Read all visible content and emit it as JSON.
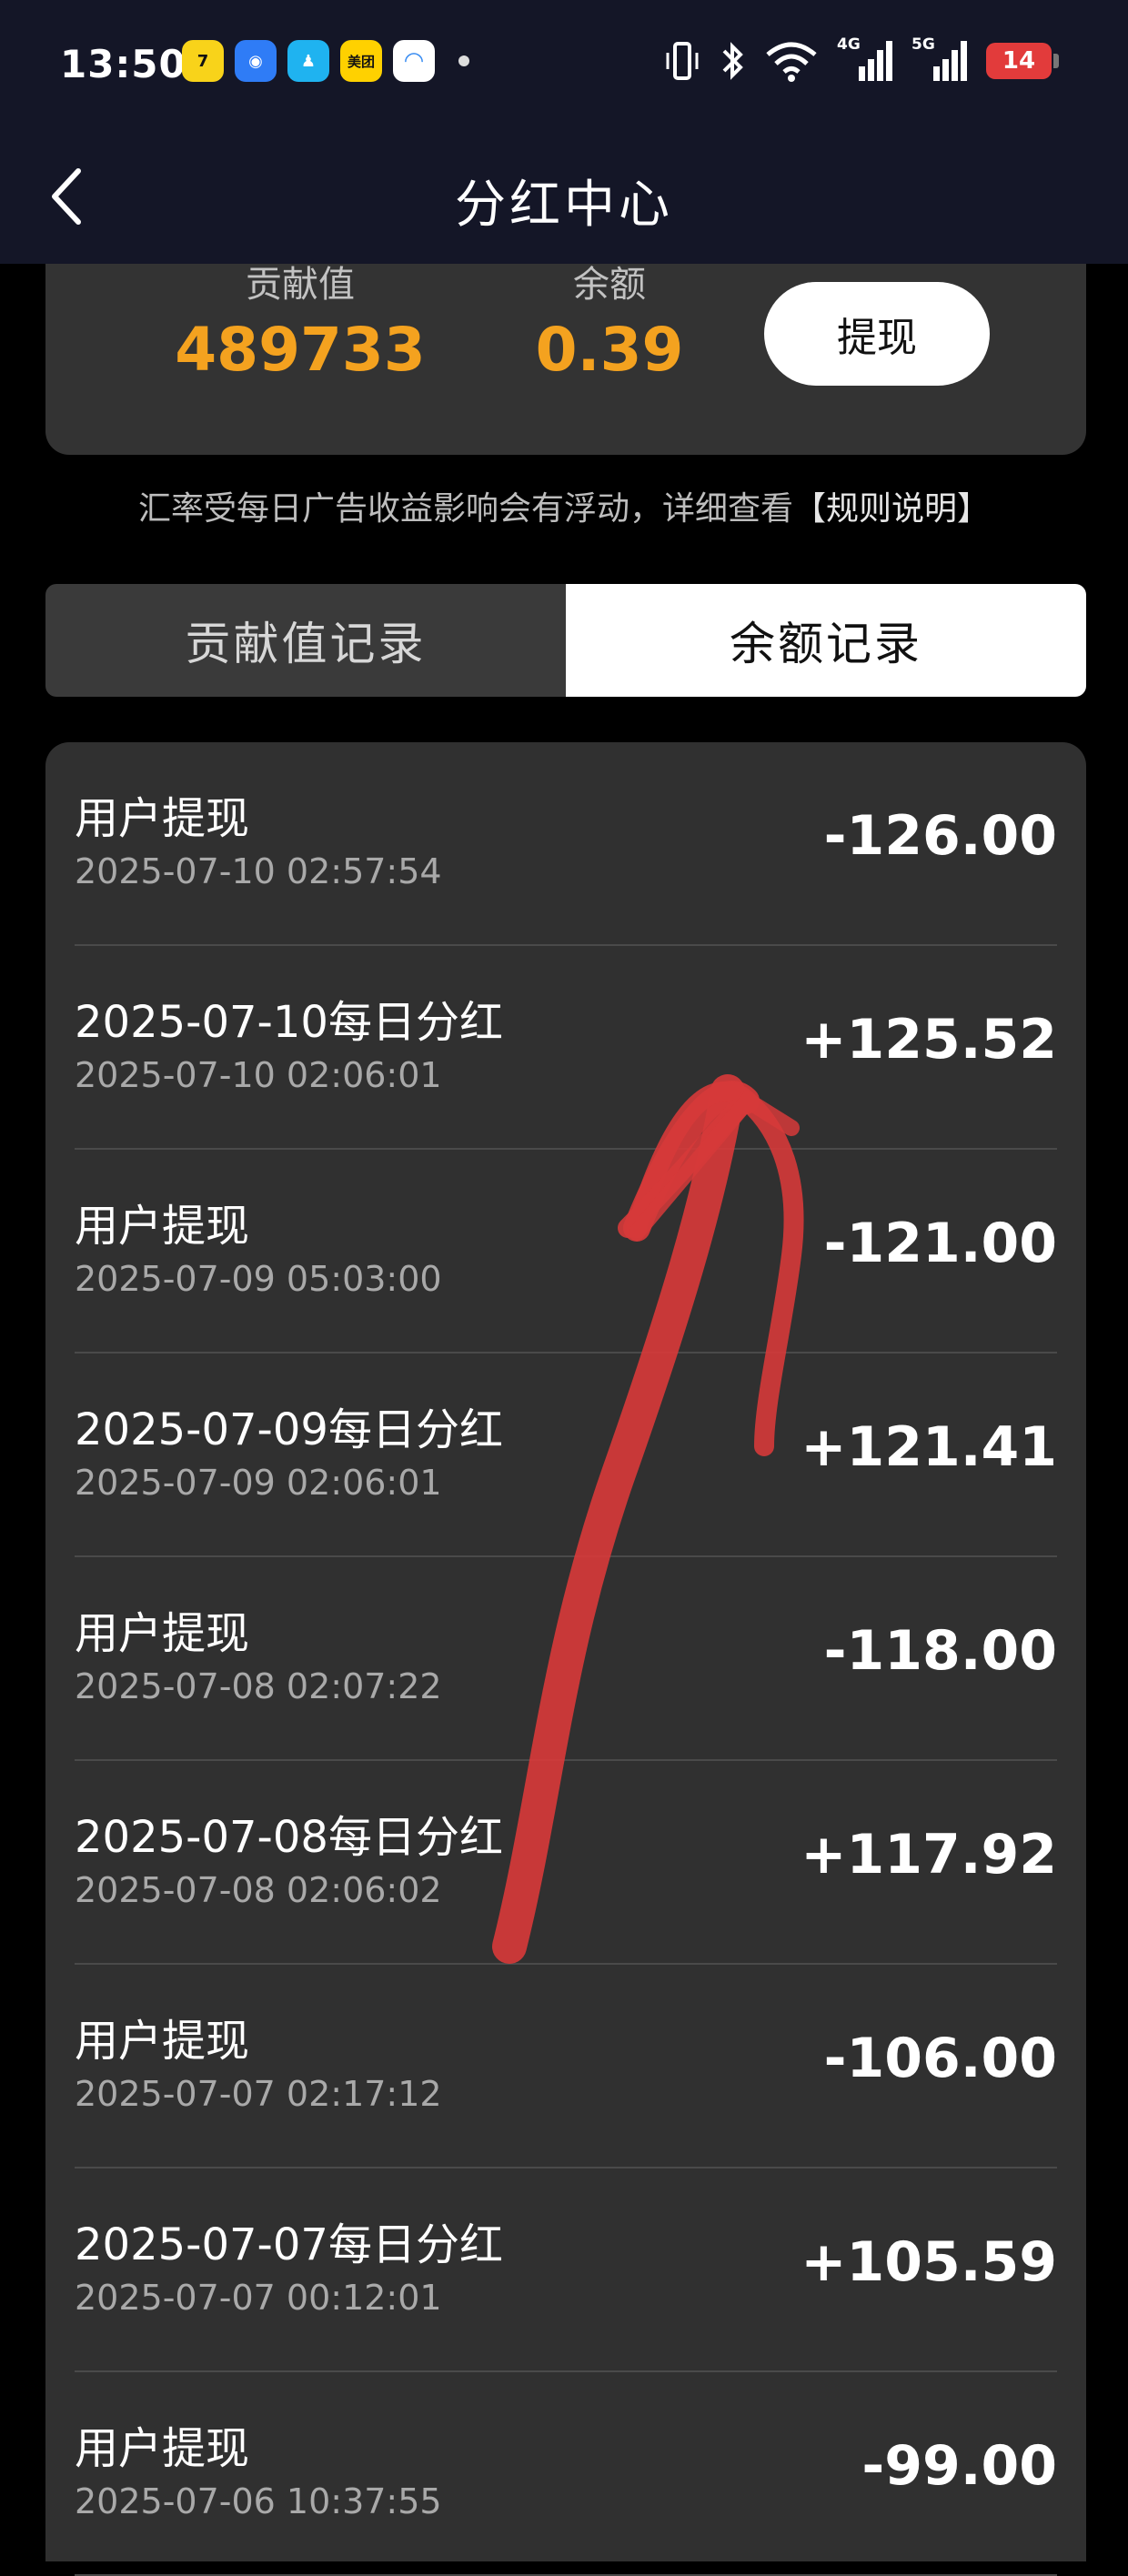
{
  "status_bar": {
    "time": "13:50",
    "apps": [
      {
        "icon": "tiger-app-icon",
        "glyph": "7",
        "color": "#f8d31a"
      },
      {
        "icon": "blue-app-icon",
        "glyph": "◉",
        "color": "#2f7cf6"
      },
      {
        "icon": "qq-penguin-icon",
        "glyph": "♟",
        "color": "#1fb3f0"
      },
      {
        "icon": "meituan-icon",
        "glyph": "美团",
        "color": "#ffd100"
      },
      {
        "icon": "blue-c-app-icon",
        "glyph": "◠",
        "color": "#3a8df2"
      }
    ],
    "net_4g": "4G",
    "net_5g": "5G",
    "battery": "14"
  },
  "header": {
    "title": "分红中心"
  },
  "summary": {
    "contribution_label": "贡献值",
    "contribution_value": "489733",
    "balance_label": "余额",
    "balance_value": "0.39",
    "withdraw_label": "提现"
  },
  "notice": {
    "text": "汇率受每日广告收益影响会有浮动，详细查看",
    "link": "【规则说明】"
  },
  "tabs": [
    {
      "label": "贡献值记录",
      "active": false
    },
    {
      "label": "余额记录",
      "active": true
    }
  ],
  "records": [
    {
      "title": "用户提现",
      "time": "2025-07-10 02:57:54",
      "amount": "-126.00"
    },
    {
      "title": "2025-07-10每日分红",
      "time": "2025-07-10 02:06:01",
      "amount": "+125.52"
    },
    {
      "title": "用户提现",
      "time": "2025-07-09 05:03:00",
      "amount": "-121.00"
    },
    {
      "title": "2025-07-09每日分红",
      "time": "2025-07-09 02:06:01",
      "amount": "+121.41"
    },
    {
      "title": "用户提现",
      "time": "2025-07-08 02:07:22",
      "amount": "-118.00"
    },
    {
      "title": "2025-07-08每日分红",
      "time": "2025-07-08 02:06:02",
      "amount": "+117.92"
    },
    {
      "title": "用户提现",
      "time": "2025-07-07 02:17:12",
      "amount": "-106.00"
    },
    {
      "title": "2025-07-07每日分红",
      "time": "2025-07-07 00:12:01",
      "amount": "+105.59"
    },
    {
      "title": "用户提现",
      "time": "2025-07-06 10:37:55",
      "amount": "-99.00"
    }
  ],
  "colors": {
    "accent_value": "#f4a21f",
    "header_bg": "#141627",
    "card_bg": "#333333",
    "annotation": "#d63a3a"
  }
}
